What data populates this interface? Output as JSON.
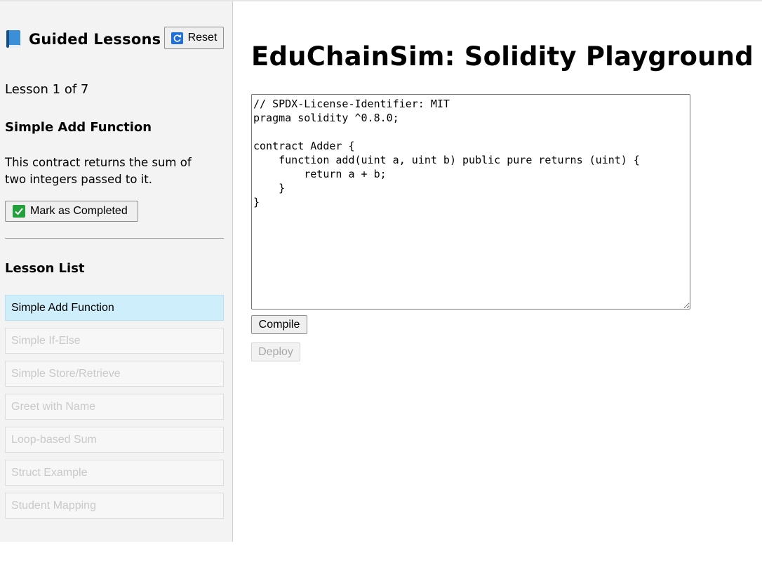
{
  "sidebar": {
    "title": "Guided Lessons",
    "reset_label": "Reset",
    "progress": "Lesson 1 of 7",
    "current_lesson": {
      "title": "Simple Add Function",
      "description": "This contract returns the sum of two integers passed to it."
    },
    "complete_label": "Mark as Completed",
    "list_heading": "Lesson List",
    "lessons": [
      {
        "label": "Simple Add Function",
        "state": "active"
      },
      {
        "label": "Simple If-Else",
        "state": "locked"
      },
      {
        "label": "Simple Store/Retrieve",
        "state": "locked"
      },
      {
        "label": "Greet with Name",
        "state": "locked"
      },
      {
        "label": "Loop-based Sum",
        "state": "locked"
      },
      {
        "label": "Struct Example",
        "state": "locked"
      },
      {
        "label": "Student Mapping",
        "state": "locked"
      }
    ]
  },
  "main": {
    "title": "EduChainSim: Solidity Playground",
    "code": "// SPDX-License-Identifier: MIT\npragma solidity ^0.8.0;\n\ncontract Adder {\n    function add(uint a, uint b) public pure returns (uint) {\n        return a + b;\n    }\n}",
    "compile_label": "Compile",
    "deploy_label": "Deploy",
    "deploy_enabled": false
  },
  "icons": {
    "title_icon": "blue-book-icon",
    "reset_icon": "refresh-icon",
    "complete_icon": "check-mark-icon"
  },
  "colors": {
    "active_lesson_bg": "#cfeefc",
    "locked_lesson_text": "#c9c9c9",
    "sidebar_bg": "#f3f3f3"
  }
}
